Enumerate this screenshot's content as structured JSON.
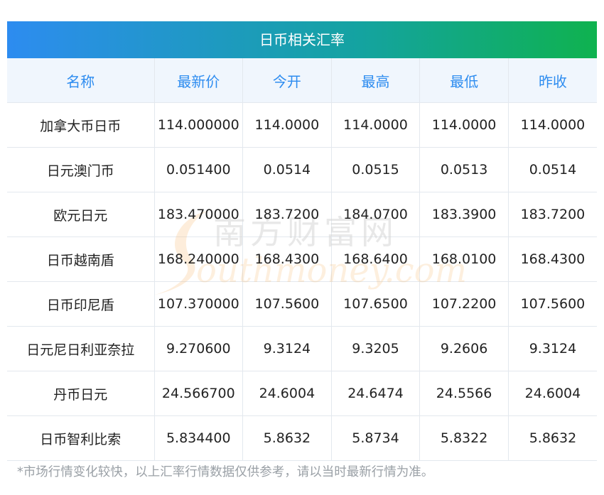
{
  "title": "日币相关汇率",
  "headers": [
    "名称",
    "最新价",
    "今开",
    "最高",
    "最低",
    "昨收"
  ],
  "rows": [
    [
      "加拿大币日币",
      "114.000000",
      "114.0000",
      "114.0000",
      "114.0000",
      "114.0000"
    ],
    [
      "日元澳门币",
      "0.051400",
      "0.0514",
      "0.0515",
      "0.0513",
      "0.0514"
    ],
    [
      "欧元日元",
      "183.470000",
      "183.7200",
      "184.0700",
      "183.3900",
      "183.7200"
    ],
    [
      "日币越南盾",
      "168.240000",
      "168.4300",
      "168.6400",
      "168.0100",
      "168.4300"
    ],
    [
      "日币印尼盾",
      "107.370000",
      "107.5600",
      "107.6500",
      "107.2200",
      "107.5600"
    ],
    [
      "日元尼日利亚奈拉",
      "9.270600",
      "9.3124",
      "9.3205",
      "9.2606",
      "9.3124"
    ],
    [
      "丹币日元",
      "24.566700",
      "24.6004",
      "24.6474",
      "24.5566",
      "24.6004"
    ],
    [
      "日币智利比索",
      "5.834400",
      "5.8632",
      "5.8734",
      "5.8322",
      "5.8632"
    ]
  ],
  "footnote": "*市场行情变化较快，以上汇率行情数据仅供参考，请以当时最新行情为准。",
  "watermark": {
    "cn": "南方财富网",
    "en": "outhmoney.com"
  },
  "colors": {
    "gradient_start": "#2d8cf0",
    "gradient_end": "#0fb24f",
    "header_text": "#2d8cf0",
    "header_bg": "#f0f6fd"
  }
}
